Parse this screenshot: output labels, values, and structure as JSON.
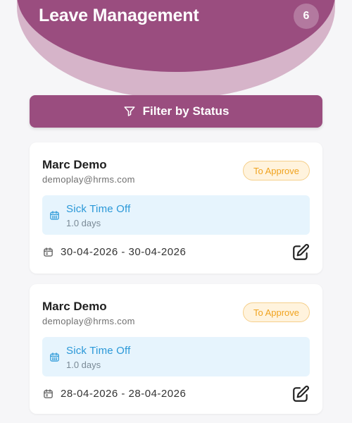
{
  "header": {
    "title": "Leave Management",
    "count_badge": "6"
  },
  "filter": {
    "label": "Filter by Status",
    "icon": "filter-icon"
  },
  "colors": {
    "primary": "#9a4d7f",
    "secondary_wave": "#d6b4c9",
    "status_pending": "#f0a31f",
    "leave_type_text": "#2a98d8",
    "leave_type_bg": "#e6f4fd"
  },
  "leaves": [
    {
      "name": "Marc Demo",
      "email": "demoplay@hrms.com",
      "status": "To Approve",
      "type": "Sick Time Off",
      "days": "1.0 days",
      "date_range": "30-04-2026 - 30-04-2026"
    },
    {
      "name": "Marc Demo",
      "email": "demoplay@hrms.com",
      "status": "To Approve",
      "type": "Sick Time Off",
      "days": "1.0 days",
      "date_range": "28-04-2026 - 28-04-2026"
    }
  ]
}
